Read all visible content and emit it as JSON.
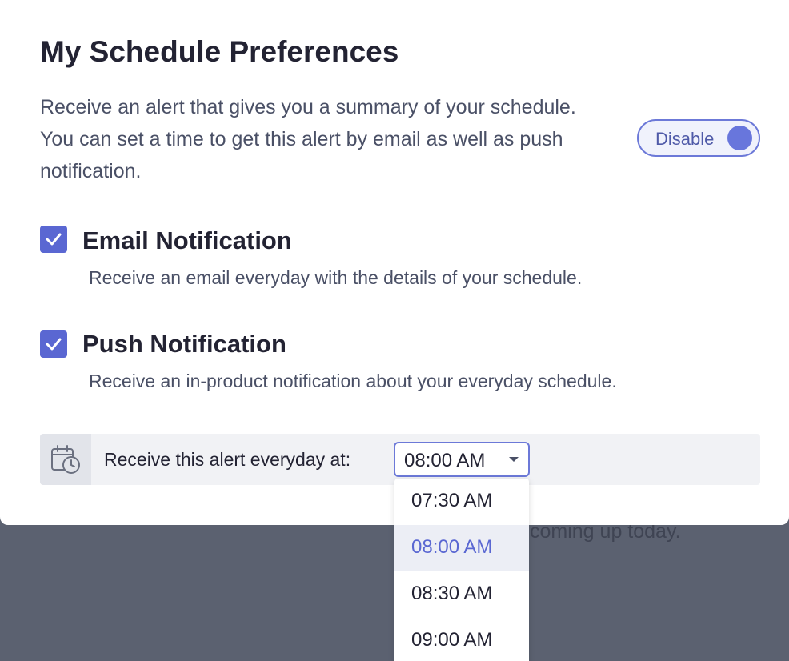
{
  "title": "My Schedule Preferences",
  "description": "Receive an alert that gives you a summary of your schedule. You can set a time to get this alert by email as well as push notification.",
  "toggle": {
    "label": "Disable"
  },
  "options": [
    {
      "title": "Email Notification",
      "description": "Receive an email everyday with the details of your schedule.",
      "checked": true
    },
    {
      "title": "Push Notification",
      "description": "Receive an in-product notification about your everyday schedule.",
      "checked": true
    }
  ],
  "alert_time": {
    "label": "Receive this alert everyday at:",
    "selected": "08:00 AM",
    "options": [
      "07:30 AM",
      "08:00 AM",
      "08:30 AM",
      "09:00 AM"
    ]
  },
  "background": {
    "partial_text": "coming up today."
  },
  "colors": {
    "accent": "#5a67d2",
    "toggle_border": "#6c79d8",
    "backdrop": "#5b6170",
    "selected_item_bg": "#eceef5"
  },
  "icons": [
    "checkmark-icon",
    "calendar-clock-icon",
    "caret-down-icon"
  ]
}
